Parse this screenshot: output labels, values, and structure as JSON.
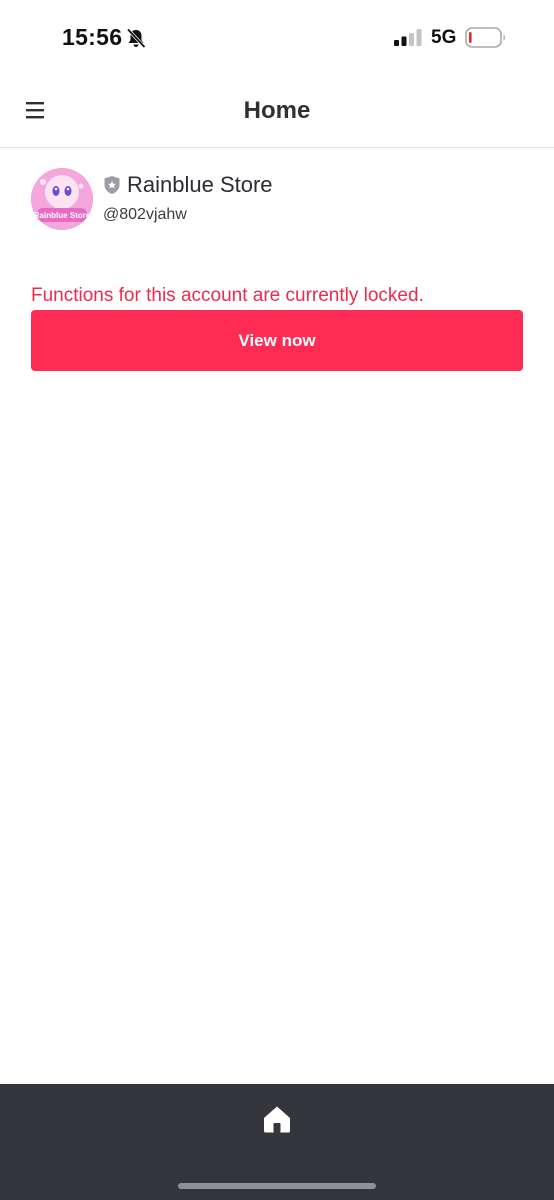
{
  "status_bar": {
    "time": "15:56",
    "network": "5G",
    "icons": [
      "bell-muted-icon",
      "signal-icon",
      "battery-low-icon"
    ]
  },
  "nav": {
    "title": "Home",
    "menu_icon": "hamburger-menu-icon"
  },
  "profile": {
    "avatar_text": "Rainblue Store",
    "badge_icon": "shield-icon",
    "name": "Rainblue Store",
    "handle": "@802vjahw"
  },
  "notice": {
    "message": "Functions for this account are currently locked.",
    "button_label": "View now"
  },
  "tab_bar": {
    "items": [
      {
        "icon": "home-icon"
      }
    ]
  },
  "colors": {
    "accent": "#fe2c55",
    "error_text": "#ea2c4e",
    "tab_bar_bg": "#34363c"
  }
}
